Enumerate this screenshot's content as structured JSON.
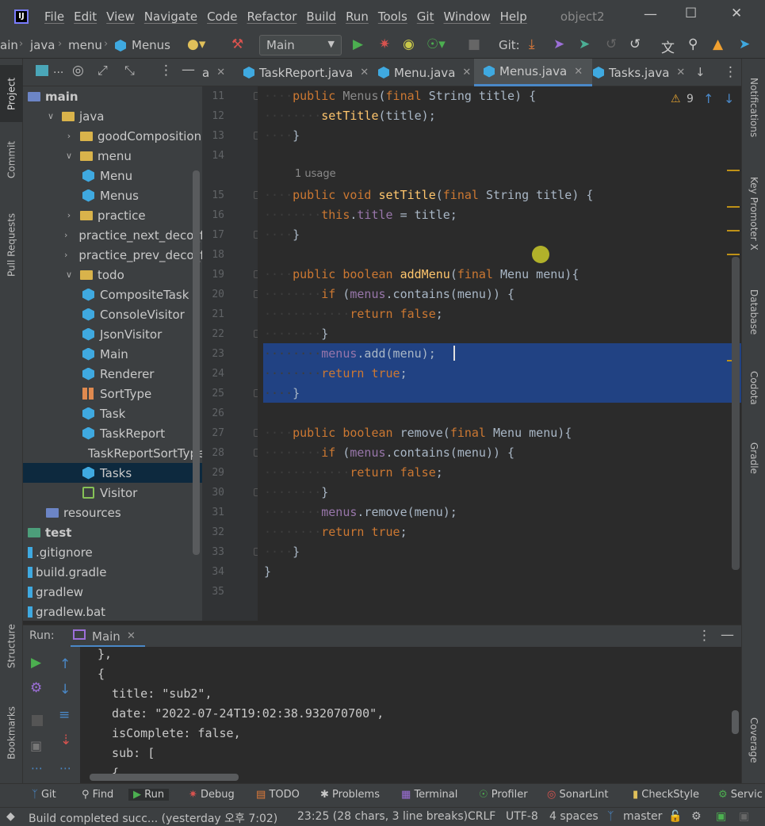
{
  "menubar": {
    "items": [
      "File",
      "Edit",
      "View",
      "Navigate",
      "Code",
      "Refactor",
      "Build",
      "Run",
      "Tools",
      "Git",
      "Window",
      "Help"
    ],
    "window_title": "object2"
  },
  "breadcrumb": {
    "parts": [
      "ain",
      "java",
      "menu",
      "Menus"
    ]
  },
  "toolbar": {
    "run_config": "Main",
    "git_label": "Git:"
  },
  "project": {
    "header_label": "...",
    "rows": [
      {
        "label": "main",
        "kind": "module",
        "indent": 0,
        "arrow": ""
      },
      {
        "label": "java",
        "kind": "folder",
        "indent": 1,
        "arrow": "v"
      },
      {
        "label": "goodComposition",
        "kind": "folder",
        "indent": 2,
        "arrow": ">"
      },
      {
        "label": "menu",
        "kind": "folder",
        "indent": 2,
        "arrow": "v"
      },
      {
        "label": "Menu",
        "kind": "class",
        "indent": 3,
        "arrow": ""
      },
      {
        "label": "Menus",
        "kind": "class",
        "indent": 3,
        "arrow": ""
      },
      {
        "label": "practice",
        "kind": "folder",
        "indent": 2,
        "arrow": ">"
      },
      {
        "label": "practice_next_deco_for",
        "kind": "folder",
        "indent": 2,
        "arrow": ">"
      },
      {
        "label": "practice_prev_deco_for",
        "kind": "folder",
        "indent": 2,
        "arrow": ">"
      },
      {
        "label": "todo",
        "kind": "folder",
        "indent": 2,
        "arrow": "v"
      },
      {
        "label": "CompositeTask",
        "kind": "class",
        "indent": 3,
        "arrow": ""
      },
      {
        "label": "ConsoleVisitor",
        "kind": "class",
        "indent": 3,
        "arrow": ""
      },
      {
        "label": "JsonVisitor",
        "kind": "class",
        "indent": 3,
        "arrow": ""
      },
      {
        "label": "Main",
        "kind": "class",
        "indent": 3,
        "arrow": ""
      },
      {
        "label": "Renderer",
        "kind": "class",
        "indent": 3,
        "arrow": ""
      },
      {
        "label": "SortType",
        "kind": "enum",
        "indent": 3,
        "arrow": ""
      },
      {
        "label": "Task",
        "kind": "class",
        "indent": 3,
        "arrow": ""
      },
      {
        "label": "TaskReport",
        "kind": "class",
        "indent": 3,
        "arrow": ""
      },
      {
        "label": "TaskReportSortType",
        "kind": "enum",
        "indent": 3,
        "arrow": ""
      },
      {
        "label": "Tasks",
        "kind": "class",
        "indent": 3,
        "arrow": "",
        "selected": true
      },
      {
        "label": "Visitor",
        "kind": "interface",
        "indent": 3,
        "arrow": ""
      },
      {
        "label": "resources",
        "kind": "resfolder",
        "indent": 1,
        "arrow": ""
      },
      {
        "label": "test",
        "kind": "test",
        "indent": 0,
        "arrow": ""
      },
      {
        "label": ".gitignore",
        "kind": "file",
        "indent": 0,
        "arrow": ""
      },
      {
        "label": "build.gradle",
        "kind": "file",
        "indent": 0,
        "arrow": ""
      },
      {
        "label": "gradlew",
        "kind": "file",
        "indent": 0,
        "arrow": ""
      },
      {
        "label": "gradlew.bat",
        "kind": "file",
        "indent": 0,
        "arrow": ""
      }
    ]
  },
  "tabs": [
    {
      "label": "a",
      "active": false
    },
    {
      "label": "TaskReport.java",
      "active": false
    },
    {
      "label": "Menu.java",
      "active": false
    },
    {
      "label": "Menus.java",
      "active": true
    },
    {
      "label": "Tasks.java",
      "active": false
    }
  ],
  "editor": {
    "warnings": "9",
    "usage_hint": "1 usage",
    "lines": [
      {
        "n": "11",
        "t": "    public Menus(final String title) {"
      },
      {
        "n": "12",
        "t": "        setTitle(title);"
      },
      {
        "n": "13",
        "t": "    }"
      },
      {
        "n": "14",
        "t": ""
      },
      {
        "n": "15",
        "t": "    public void setTitle(final String title) {"
      },
      {
        "n": "16",
        "t": "        this.title = title;"
      },
      {
        "n": "17",
        "t": "    }"
      },
      {
        "n": "18",
        "t": ""
      },
      {
        "n": "19",
        "t": "    public boolean addMenu(final Menu menu){"
      },
      {
        "n": "20",
        "t": "        if (menus.contains(menu)) {"
      },
      {
        "n": "21",
        "t": "            return false;"
      },
      {
        "n": "22",
        "t": "        }"
      },
      {
        "n": "23",
        "t": "        menus.add(menu);"
      },
      {
        "n": "24",
        "t": "        return true;"
      },
      {
        "n": "25",
        "t": "    }"
      },
      {
        "n": "26",
        "t": ""
      },
      {
        "n": "27",
        "t": "    public boolean remove(final Menu menu){"
      },
      {
        "n": "28",
        "t": "        if (menus.contains(menu)) {"
      },
      {
        "n": "29",
        "t": "            return false;"
      },
      {
        "n": "30",
        "t": "        }"
      },
      {
        "n": "31",
        "t": "        menus.remove(menu);"
      },
      {
        "n": "32",
        "t": "        return true;"
      },
      {
        "n": "33",
        "t": "    }"
      },
      {
        "n": "34",
        "t": "}"
      },
      {
        "n": "35",
        "t": ""
      }
    ]
  },
  "run": {
    "label": "Run:",
    "tab": "Main",
    "console": [
      "},",
      "{",
      "  title: \"sub2\",",
      "  date: \"2022-07-24T19:02:38.932070700\",",
      "  isComplete: false,",
      "  sub: [",
      "  {"
    ]
  },
  "left_tabs": [
    "Project",
    "Commit",
    "Pull Requests",
    "Structure",
    "Bookmarks"
  ],
  "right_tabs": [
    "Notifications",
    "Key Promoter X",
    "Database",
    "Codota",
    "Gradle",
    "Coverage"
  ],
  "toolwindows": [
    "Git",
    "Find",
    "Run",
    "Debug",
    "TODO",
    "Problems",
    "Terminal",
    "Profiler",
    "SonarLint",
    "CheckStyle",
    "Servic"
  ],
  "status": {
    "message": "Build completed succ... (yesterday 오후 7:02)",
    "position": "23:25 (28 chars, 3 line breaks)",
    "line_sep": "CRLF",
    "encoding": "UTF-8",
    "indent": "4 spaces",
    "branch": "master"
  }
}
